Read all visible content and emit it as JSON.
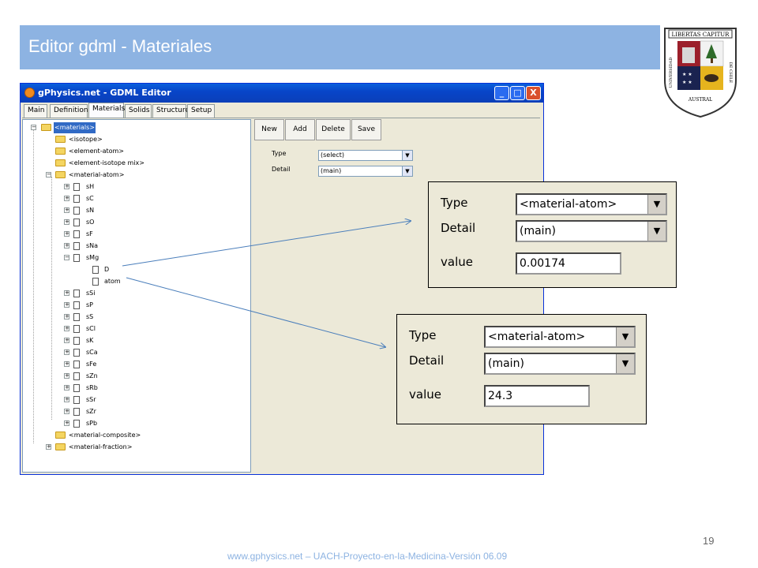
{
  "slide": {
    "title": "Editor gdml - Materiales",
    "footer": "www.gphysics.net – UACH-Proyecto-en-la-Medicina-Versión 06.09",
    "page_number": "19",
    "accent_color": "#8db3e2"
  },
  "logo": {
    "text_top": "LIBERTAS CAPITUR",
    "text_left": "UNIVERSIDAD",
    "text_bottom": "AUSTRAL",
    "text_right": "DE CHILE"
  },
  "window": {
    "title": "gPhysics.net - GDML Editor",
    "minimize_glyph": "_",
    "maximize_glyph": "□",
    "close_glyph": "X",
    "tabs": [
      "Main",
      "Definition",
      "Materials",
      "Solids",
      "Structure",
      "Setup"
    ],
    "active_tab": "Materials"
  },
  "tree": {
    "root": "<materials>",
    "isotope": "<isotope>",
    "element_atom": "<element-atom>",
    "element_isotope_mix": "<element-isotope mix>",
    "material_atom": "<material-atom>",
    "materials": [
      "sH",
      "sC",
      "sN",
      "sO",
      "sF",
      "sNa",
      "sMg"
    ],
    "smg_children": [
      "D",
      "atom"
    ],
    "materials_after": [
      "sSi",
      "sP",
      "sS",
      "sCl",
      "sK",
      "sCa",
      "sFe",
      "sZn",
      "sRb",
      "sSr",
      "sZr",
      "sPb"
    ],
    "material_composite": "<material-composite>",
    "material_fraction": "<material-fraction>",
    "expand_glyph": "+",
    "collapse_glyph": "−"
  },
  "toolbar": {
    "new_label": "New",
    "add_label": "Add",
    "delete_label": "Delete",
    "save_label": "Save"
  },
  "form": {
    "type_label": "Type",
    "type_value": "(select)",
    "detail_label": "Detail",
    "detail_value": "(main)",
    "arrow_glyph": "▼"
  },
  "callout_d": {
    "type_label": "Type",
    "type_value": "<material-atom>",
    "detail_label": "Detail",
    "detail_value": "(main)",
    "value_label": "value",
    "value": "0.00174"
  },
  "callout_atom": {
    "type_label": "Type",
    "type_value": "<material-atom>",
    "detail_label": "Detail",
    "detail_value": "(main)",
    "value_label": "value",
    "value": "24.3"
  }
}
